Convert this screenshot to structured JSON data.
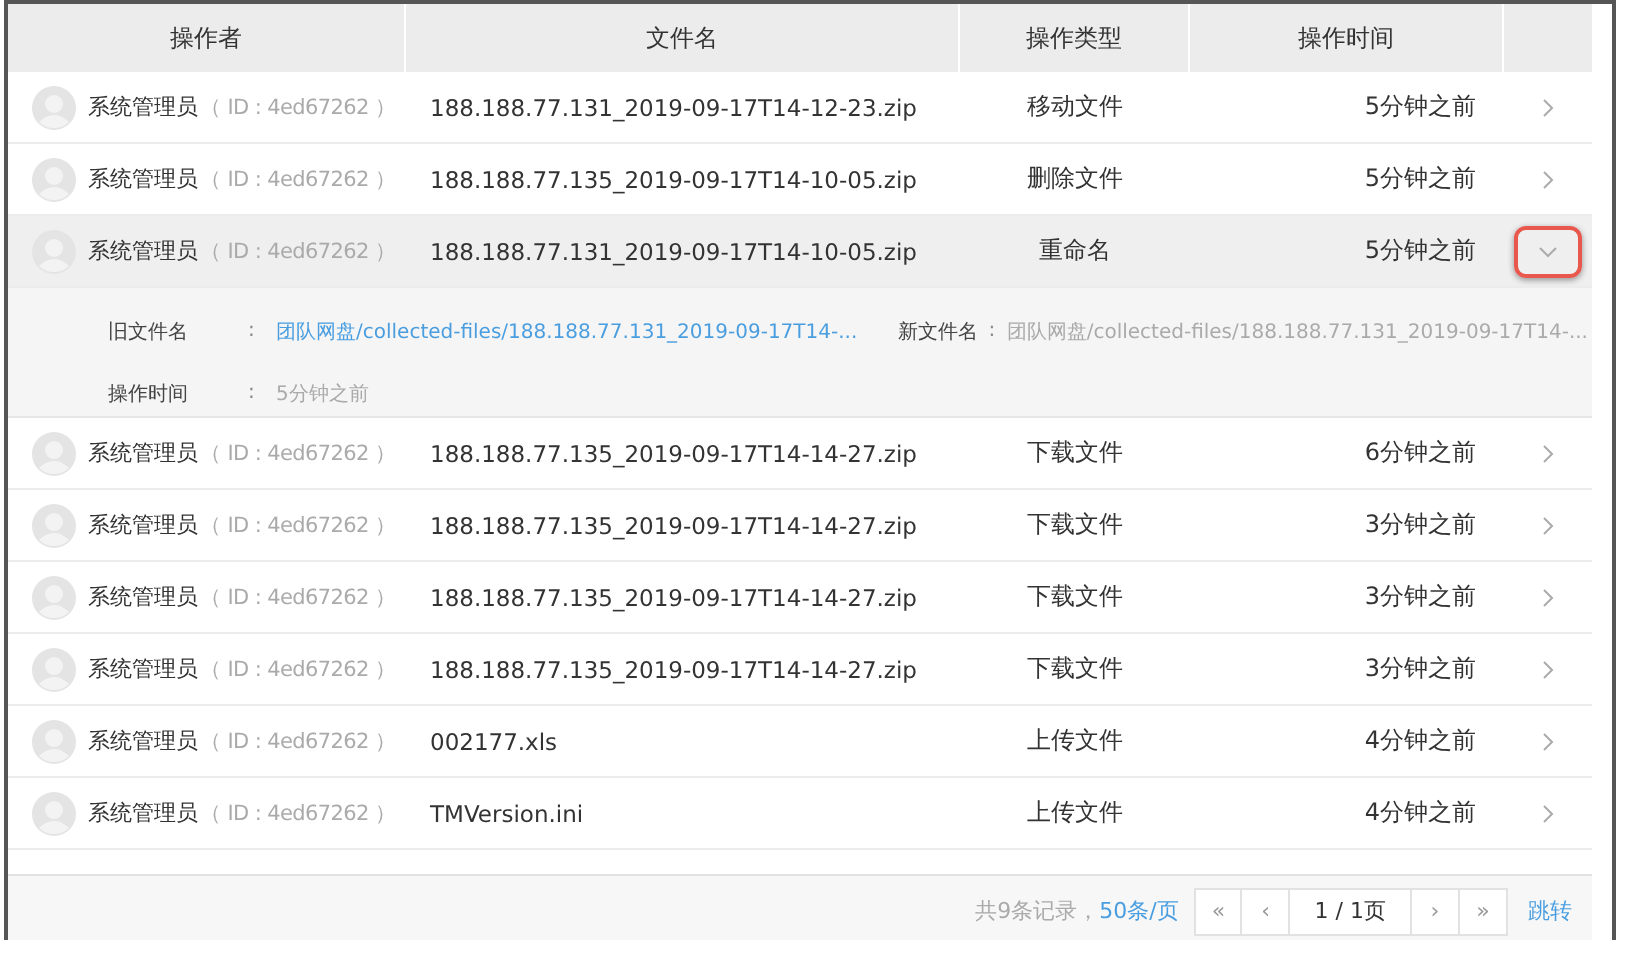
{
  "table": {
    "columns": [
      "操作者",
      "文件名",
      "操作类型",
      "操作时间"
    ],
    "rows": [
      {
        "user": "系统管理员",
        "user_id": "（ ID : 4ed67262 ）",
        "file": "188.188.77.131_2019-09-17T14-12-23.zip",
        "type": "移动文件",
        "time": "5分钟之前",
        "expanded": false,
        "highlighted": false
      },
      {
        "user": "系统管理员",
        "user_id": "（ ID : 4ed67262 ）",
        "file": "188.188.77.135_2019-09-17T14-10-05.zip",
        "type": "删除文件",
        "time": "5分钟之前",
        "expanded": false,
        "highlighted": false
      },
      {
        "user": "系统管理员",
        "user_id": "（ ID : 4ed67262 ）",
        "file": "188.188.77.131_2019-09-17T14-10-05.zip",
        "type": "重命名",
        "time": "5分钟之前",
        "expanded": true,
        "highlighted": true,
        "detail": {
          "old_label": "旧文件名",
          "old_value": "团队网盘/collected-files/188.188.77.131_2019-09-17T14-...",
          "new_label": "新文件名",
          "new_value": "团队网盘/collected-files/188.188.77.131_2019-09-17T14-...",
          "time_label": "操作时间",
          "time_value": "5分钟之前",
          "separator": ":"
        }
      },
      {
        "user": "系统管理员",
        "user_id": "（ ID : 4ed67262 ）",
        "file": "188.188.77.135_2019-09-17T14-14-27.zip",
        "type": "下载文件",
        "time": "6分钟之前",
        "expanded": false,
        "highlighted": false
      },
      {
        "user": "系统管理员",
        "user_id": "（ ID : 4ed67262 ）",
        "file": "188.188.77.135_2019-09-17T14-14-27.zip",
        "type": "下载文件",
        "time": "3分钟之前",
        "expanded": false,
        "highlighted": false
      },
      {
        "user": "系统管理员",
        "user_id": "（ ID : 4ed67262 ）",
        "file": "188.188.77.135_2019-09-17T14-14-27.zip",
        "type": "下载文件",
        "time": "3分钟之前",
        "expanded": false,
        "highlighted": false
      },
      {
        "user": "系统管理员",
        "user_id": "（ ID : 4ed67262 ）",
        "file": "188.188.77.135_2019-09-17T14-14-27.zip",
        "type": "下载文件",
        "time": "3分钟之前",
        "expanded": false,
        "highlighted": false
      },
      {
        "user": "系统管理员",
        "user_id": "（ ID : 4ed67262 ）",
        "file": "002177.xls",
        "type": "上传文件",
        "time": "4分钟之前",
        "expanded": false,
        "highlighted": false
      },
      {
        "user": "系统管理员",
        "user_id": "（ ID : 4ed67262 ）",
        "file": "TMVersion.ini",
        "type": "上传文件",
        "time": "4分钟之前",
        "expanded": false,
        "highlighted": false
      }
    ]
  },
  "pagination": {
    "total": "共9条记录，",
    "page_size": "50条/页",
    "first": "«",
    "prev": "‹",
    "page": "1 / 1页",
    "next": "›",
    "last": "»",
    "jump": "跳转"
  }
}
